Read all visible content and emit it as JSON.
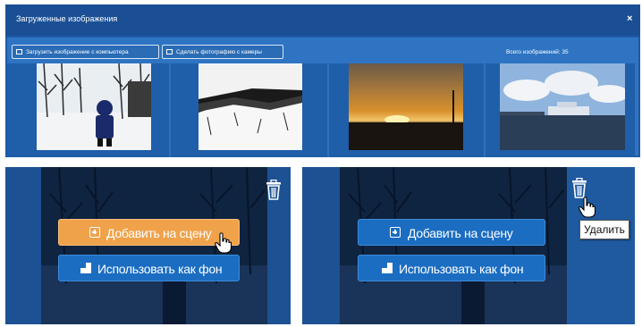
{
  "dialog": {
    "title": "Загруженные изображения",
    "close_label": "×",
    "upload_button": "Загрузить изображение с компьютера",
    "camera_button": "Сделать фотографию с камеры",
    "total_label": "Всего изображений: 35"
  },
  "thumbnails": [
    {
      "name": "snow-child",
      "colors": {
        "sky": "#e9eef3",
        "snow": "#f3f4f6",
        "trees": "#2a2a2a",
        "figure": "#1b2a6b"
      }
    },
    {
      "name": "snow-landscape",
      "colors": {
        "sky": "#f2f2f2",
        "snow": "#f7f7f7",
        "dark": "#1a1a1a"
      }
    },
    {
      "name": "sunset",
      "colors": {
        "sky_top": "#6a5a49",
        "sky_mid": "#d9912e",
        "sun": "#fff2b0",
        "ground": "#1a1410"
      }
    },
    {
      "name": "harbor",
      "colors": {
        "sky": "#8fb4de",
        "cloud": "#f2f4f7",
        "water": "#2b3e57",
        "ship": "#dfe6ee"
      }
    }
  ],
  "left_panel": {
    "add_to_scene": "Добавить на сцену",
    "use_as_background": "Использовать как фон",
    "delete_icon": "trash-icon",
    "add_button_color": "#f0a24b"
  },
  "right_panel": {
    "add_to_scene": "Добавить на сцену",
    "use_as_background": "Использовать как фон",
    "delete_icon": "trash-icon",
    "tooltip": "Удалить"
  },
  "colors": {
    "accent_blue": "#1b6dc1",
    "hover_orange": "#f0a24b",
    "dialog_header": "#1a4f95"
  }
}
